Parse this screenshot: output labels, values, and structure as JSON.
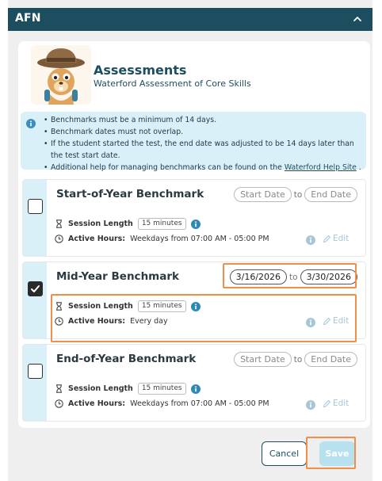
{
  "topbar": {
    "title": "AFN"
  },
  "header": {
    "title": "Assessments",
    "subtitle": "Waterford Assessment of Core Skills"
  },
  "info": {
    "items": [
      "Benchmarks must be a minimum of 14 days.",
      "Benchmark dates must not overlap.",
      "If the student started the test, the end date was adjusted to be 14 days later than the test start date."
    ],
    "help_prefix": "Additional help for managing benchmarks can be found on the ",
    "help_link": "Waterford Help Site",
    "help_suffix": " ."
  },
  "labels": {
    "to": "to",
    "session_length": "Session Length",
    "active_hours": "Active Hours:",
    "edit": "Edit"
  },
  "benchmarks": [
    {
      "name": "Start-of-Year Benchmark",
      "checked": false,
      "start_date": "Start Date",
      "end_date": "End Date",
      "session_length": "15 minutes",
      "active_hours": "Weekdays from 07:00 AM - 05:00 PM"
    },
    {
      "name": "Mid-Year Benchmark",
      "checked": true,
      "start_date": "3/16/2026",
      "end_date": "3/30/2026",
      "session_length": "15 minutes",
      "active_hours": "Every day"
    },
    {
      "name": "End-of-Year Benchmark",
      "checked": false,
      "start_date": "Start Date",
      "end_date": "End Date",
      "session_length": "15 minutes",
      "active_hours": "Weekdays from 07:00 AM - 05:00 PM"
    }
  ],
  "footer": {
    "cancel_label": "Cancel",
    "save_label": "Save"
  },
  "colors": {
    "header": "#1d4e5f",
    "info_bg": "#daf0f8",
    "highlight": "#ef8f4a",
    "save_disabled": "#b7e1ef"
  },
  "icons": {
    "collapse": "chevron-up-icon",
    "info": "info-icon",
    "hourglass": "hourglass-icon",
    "clock": "clock-icon",
    "edit": "pencil-icon",
    "checkbox_checked": "checkmark-icon"
  }
}
